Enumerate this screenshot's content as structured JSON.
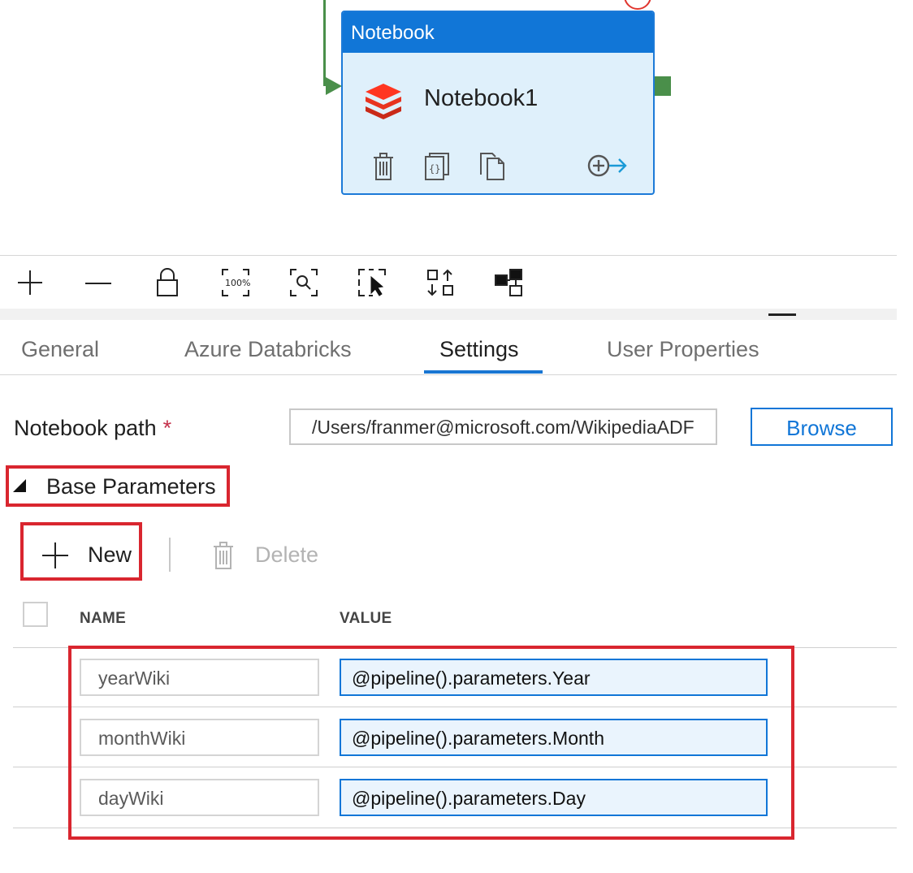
{
  "canvas": {
    "activity": {
      "type_label": "Notebook",
      "name": "Notebook1",
      "icons": [
        "databricks-logo-icon",
        "trash-icon",
        "code-braces-icon",
        "copy-icon",
        "add-output-arrow-icon"
      ]
    }
  },
  "toolbar": {
    "icons": [
      "zoom-in-icon",
      "zoom-out-icon",
      "lock-icon",
      "zoom-100-icon",
      "zoom-to-fit-icon",
      "multi-select-icon",
      "auto-align-icon",
      "minimap-icon"
    ],
    "zoom_100_text": "100%"
  },
  "tabs": [
    {
      "label": "General",
      "active": false
    },
    {
      "label": "Azure Databricks",
      "active": false
    },
    {
      "label": "Settings",
      "active": true
    },
    {
      "label": "User Properties",
      "active": false
    }
  ],
  "settings": {
    "notebook_path_label": "Notebook path",
    "required_marker": "*",
    "notebook_path_value": "/Users/franmer@microsoft.com/WikipediaADF",
    "browse_label": "Browse",
    "base_parameters_label": "Base Parameters",
    "new_label": "New",
    "delete_label": "Delete",
    "columns": {
      "name": "NAME",
      "value": "VALUE"
    },
    "parameters": [
      {
        "name": "yearWiki",
        "value": "@pipeline().parameters.Year"
      },
      {
        "name": "monthWiki",
        "value": "@pipeline().parameters.Month"
      },
      {
        "name": "dayWiki",
        "value": "@pipeline().parameters.Day"
      }
    ]
  },
  "colors": {
    "accent": "#1176d7",
    "highlight_red": "#d9262f",
    "success_green": "#4a8f4a",
    "node_background": "#dff0fb"
  }
}
